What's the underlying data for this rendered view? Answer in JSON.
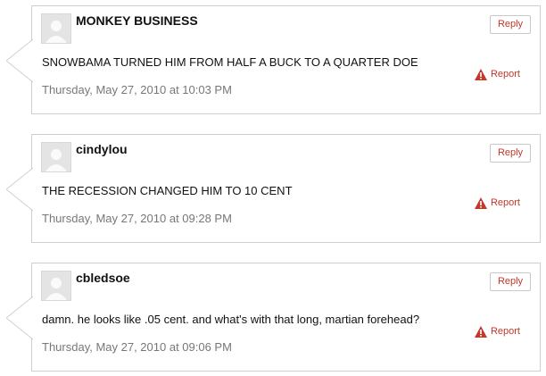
{
  "comments": [
    {
      "author": "MONKEY BUSINESS",
      "text": "SNOWBAMA TURNED HIM FROM HALF A BUCK TO A QUARTER DOE",
      "date": "Thursday, May 27, 2010 at 10:03 PM",
      "reply_label": "Reply",
      "report_label": "Report"
    },
    {
      "author": "cindylou",
      "text": "THE RECESSION CHANGED HIM TO 10 CENT",
      "date": "Thursday, May 27, 2010 at 09:28 PM",
      "reply_label": "Reply",
      "report_label": "Report"
    },
    {
      "author": "cbledsoe",
      "text": "damn. he looks like .05 cent. and what's with that long, martian forehead?",
      "date": "Thursday, May 27, 2010 at 09:06 PM",
      "reply_label": "Reply",
      "report_label": "Report"
    }
  ],
  "colors": {
    "accent": "#c0392b",
    "border": "#cfcfcf",
    "date_text": "#777777"
  },
  "icons": {
    "avatar": "default-avatar-icon",
    "report": "warning-triangle-icon"
  }
}
